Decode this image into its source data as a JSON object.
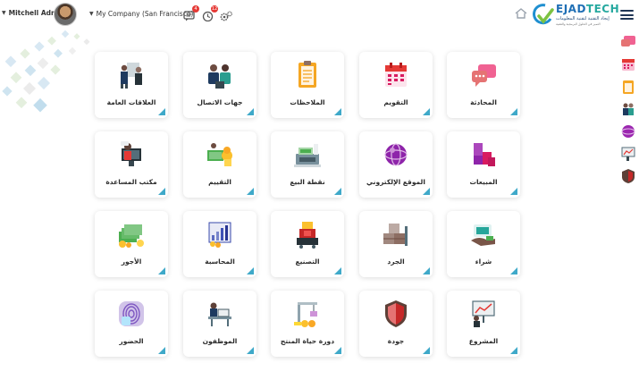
{
  "topbar": {
    "user_name": "Mitchell Admin",
    "company_name": "My Company (San Francisco)",
    "messages_count": "4",
    "activities_count": "12"
  },
  "logo": {
    "title_e": "EJAD",
    "title_t": "TECH",
    "subtitle": "إيجاد التقنية لتقنية المعلومات",
    "tagline": "التميز في الحلول البرمجية والتقنية"
  },
  "colors": {
    "accent": "#3fa9c9",
    "card_bg": "#ffffff",
    "text": "#2a2a2a"
  },
  "apps": [
    {
      "label": "العلاقات العامة",
      "icon": "people-presentation-icon"
    },
    {
      "label": "جهات الاتصال",
      "icon": "contacts-icon"
    },
    {
      "label": "الملاحظات",
      "icon": "notes-clipboard-icon"
    },
    {
      "label": "التقويم",
      "icon": "calendar-icon"
    },
    {
      "label": "المحادثة",
      "icon": "chat-bubbles-icon"
    },
    {
      "label": "مكتب المساعدة",
      "icon": "helpdesk-icon"
    },
    {
      "label": "التقييم",
      "icon": "rating-money-icon"
    },
    {
      "label": "نقطة البيع",
      "icon": "cash-register-icon"
    },
    {
      "label": "الموقع الإلكتروني",
      "icon": "website-globe-icon"
    },
    {
      "label": "المبيعات",
      "icon": "sales-cubes-icon"
    },
    {
      "label": "الأجور",
      "icon": "payroll-money-icon"
    },
    {
      "label": "المحاسبة",
      "icon": "accounting-chart-icon"
    },
    {
      "label": "التصنيع",
      "icon": "manufacturing-icon"
    },
    {
      "label": "الجرد",
      "icon": "inventory-boxes-icon"
    },
    {
      "label": "شراء",
      "icon": "purchase-hand-icon"
    },
    {
      "label": "الحضور",
      "icon": "fingerprint-icon"
    },
    {
      "label": "الموظفون",
      "icon": "employees-desk-icon"
    },
    {
      "label": "دورة حياة المنتج",
      "icon": "plm-crane-icon"
    },
    {
      "label": "جودة",
      "icon": "quality-shield-icon"
    },
    {
      "label": "المشروع",
      "icon": "project-board-icon"
    }
  ],
  "dock": [
    "chat-bubbles-icon",
    "calendar-icon",
    "notes-clipboard-icon",
    "contacts-icon",
    "website-globe-icon",
    "project-board-icon",
    "quality-shield-icon"
  ]
}
